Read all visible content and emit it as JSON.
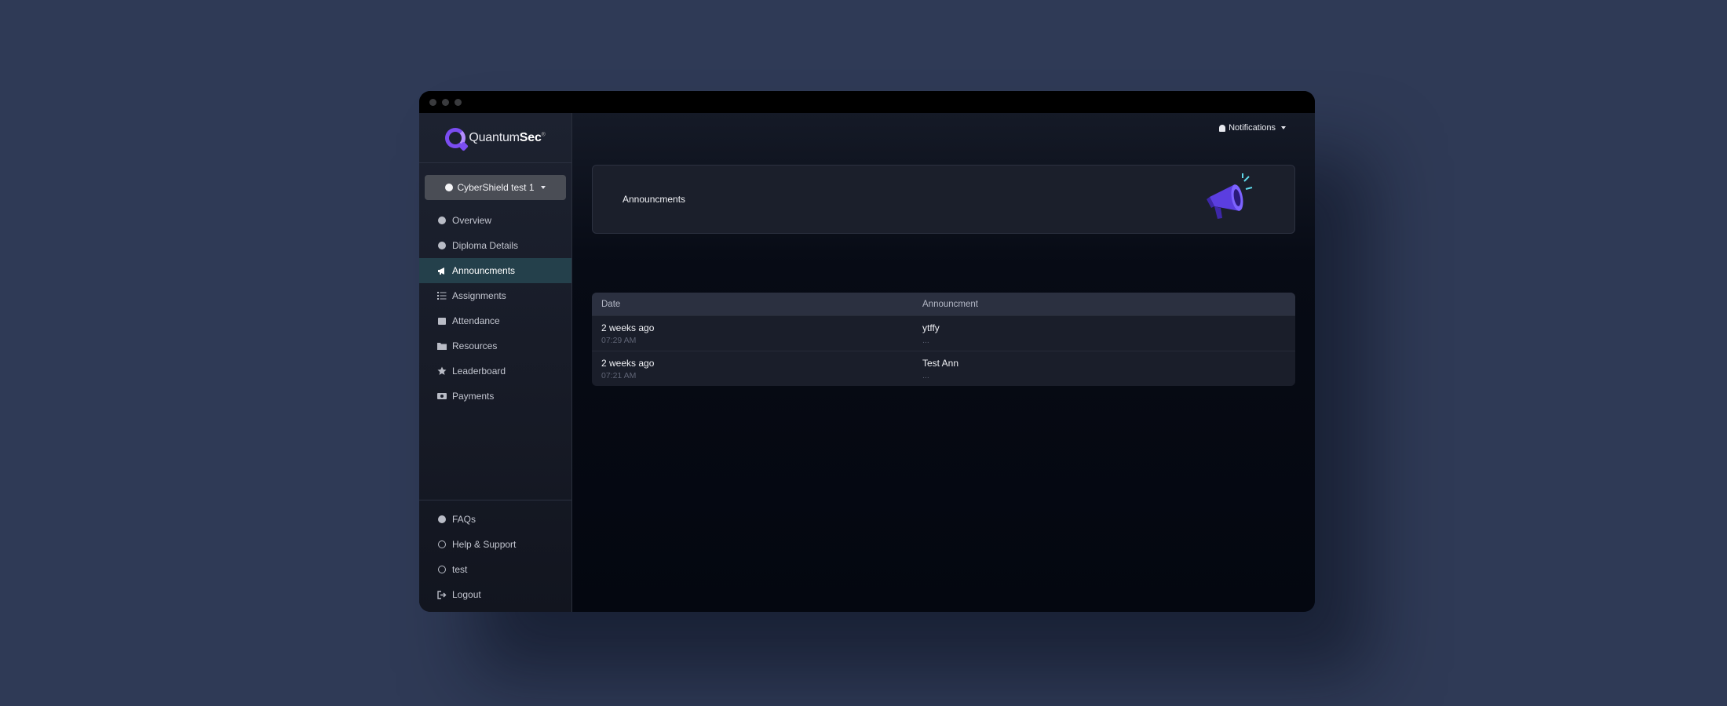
{
  "sidebar": {
    "logo": {
      "light": "Quantum",
      "bold": "Sec",
      "mark": "®"
    },
    "course_selector": "CyberShield test 1",
    "items": [
      {
        "label": "Overview",
        "icon": "gauge-icon",
        "active": false
      },
      {
        "label": "Diploma Details",
        "icon": "info-icon",
        "active": false
      },
      {
        "label": "Announcments",
        "icon": "bullhorn-icon",
        "active": true
      },
      {
        "label": "Assignments",
        "icon": "list-icon",
        "active": false
      },
      {
        "label": "Attendance",
        "icon": "calendar-icon",
        "active": false
      },
      {
        "label": "Resources",
        "icon": "folder-icon",
        "active": false
      },
      {
        "label": "Leaderboard",
        "icon": "star-icon",
        "active": false
      },
      {
        "label": "Payments",
        "icon": "money-icon",
        "active": false
      }
    ],
    "bottom_items": [
      {
        "label": "FAQs",
        "icon": "question-icon"
      },
      {
        "label": "Help & Support",
        "icon": "headset-icon"
      },
      {
        "label": "test",
        "icon": "user-circle-icon"
      },
      {
        "label": "Logout",
        "icon": "logout-icon"
      }
    ]
  },
  "header": {
    "notifications_label": "Notifications"
  },
  "banner": {
    "title": "Announcments",
    "illustration": "megaphone-illustration"
  },
  "table": {
    "columns": [
      "Date",
      "Announcment"
    ],
    "rows": [
      {
        "date": "2 weeks ago",
        "time": "07:29 AM",
        "title": "ytffy",
        "detail": "..."
      },
      {
        "date": "2 weeks ago",
        "time": "07:21 AM",
        "title": "Test Ann",
        "detail": "..."
      }
    ]
  },
  "colors": {
    "background": "#2f3a56",
    "sidebar_active": "#24404b",
    "accent": "#7b4df2"
  }
}
